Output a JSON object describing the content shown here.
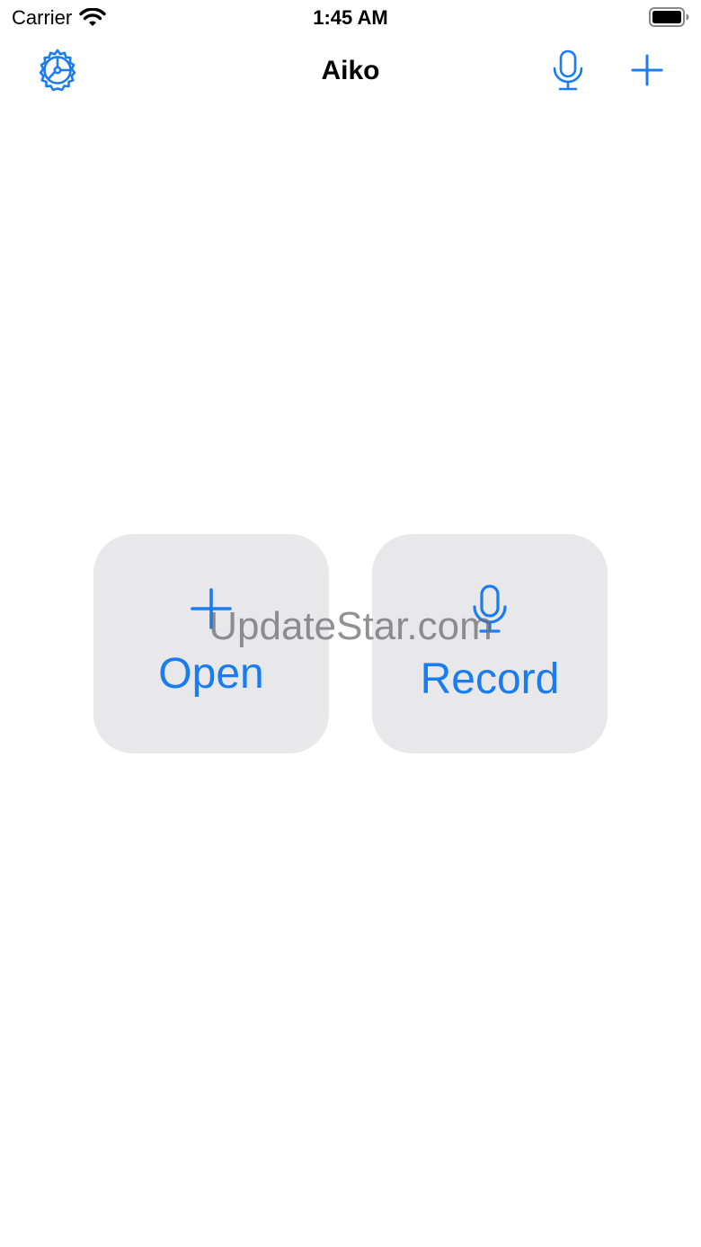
{
  "status_bar": {
    "carrier": "Carrier",
    "time": "1:45 AM",
    "icons": [
      "wifi-icon",
      "battery-icon"
    ]
  },
  "nav": {
    "title": "Aiko",
    "left_icon": "settings-gear-icon",
    "right_icons": [
      "microphone-icon",
      "plus-icon"
    ]
  },
  "actions": {
    "open": {
      "icon": "plus-icon",
      "label": "Open"
    },
    "record": {
      "icon": "microphone-icon",
      "label": "Record"
    }
  },
  "watermark": "UpdateStar.com",
  "colors": {
    "accent": "#1a7cf0",
    "tile_background": "#e8e8eb",
    "background": "#ffffff",
    "text": "#000000"
  }
}
